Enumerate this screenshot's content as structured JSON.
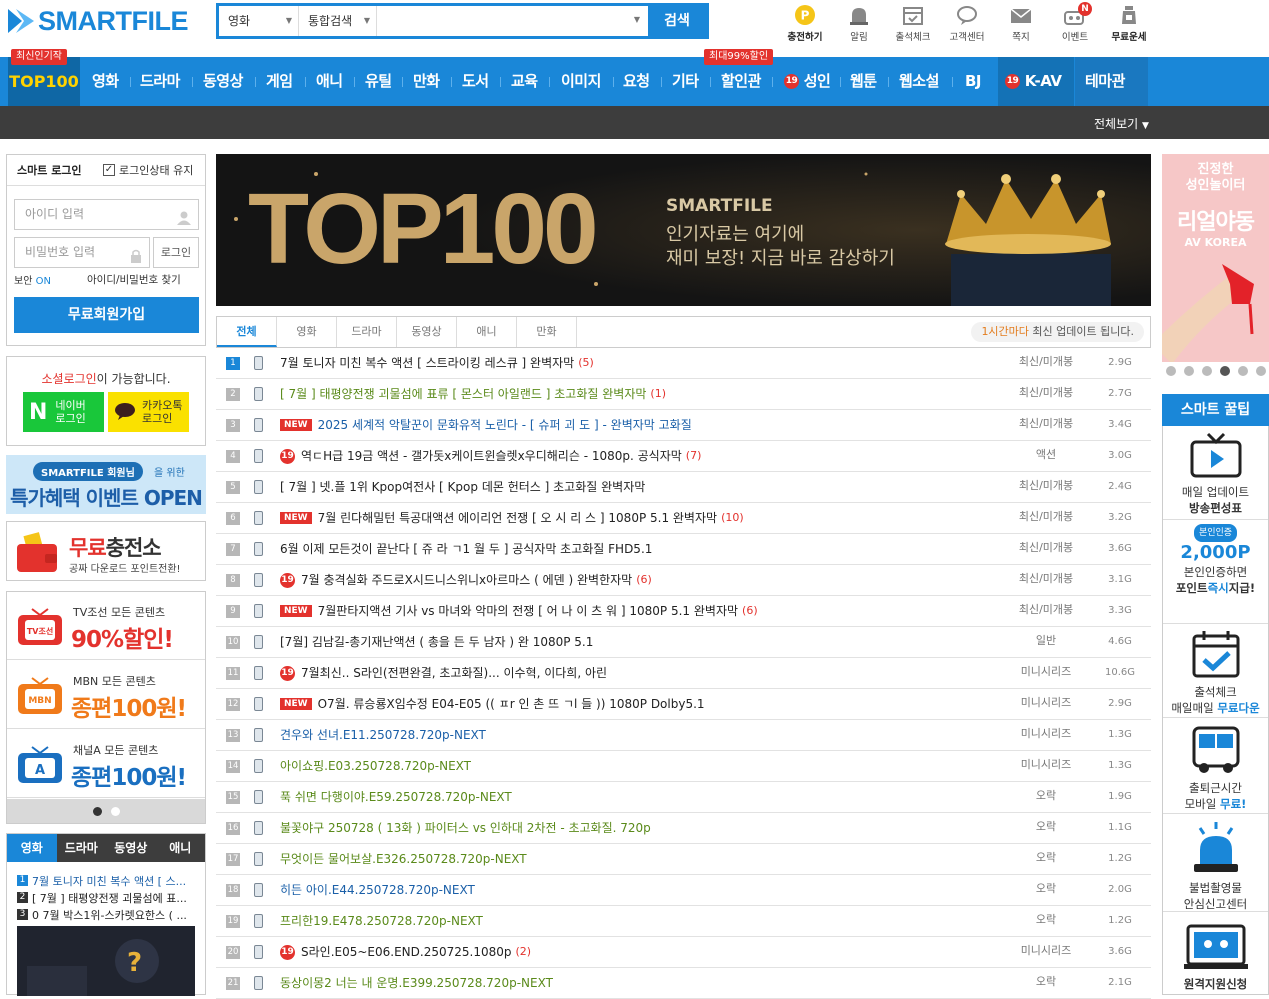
{
  "header": {
    "logo_text": "SMARTFILE",
    "search": {
      "category": "영화",
      "scope": "통합검색",
      "button": "검색",
      "placeholder": ""
    },
    "quick_links": [
      {
        "label": "충전하기",
        "icon": "coin-icon"
      },
      {
        "label": "알림",
        "icon": "alarm-icon"
      },
      {
        "label": "출석체크",
        "icon": "calendar-check-icon"
      },
      {
        "label": "고객센터",
        "icon": "chat-bubble-icon"
      },
      {
        "label": "쪽지",
        "icon": "mail-icon"
      },
      {
        "label": "이벤트",
        "icon": "gift-icon",
        "badge": "N"
      },
      {
        "label": "무료운세",
        "icon": "fortune-jar-icon"
      }
    ]
  },
  "nav": {
    "top100": "TOP100",
    "top100_flag": "최신인기작",
    "discount_flag": "최대99%할인",
    "items": [
      "영화",
      "드라마",
      "동영상",
      "게임",
      "애니",
      "유틸",
      "만화",
      "도서",
      "교육",
      "이미지",
      "요청",
      "기타",
      "할인관",
      "성인",
      "웹툰",
      "웹소설",
      "BJ",
      "K-AV",
      "테마관"
    ],
    "adult_badge": "19",
    "view_all": "전체보기"
  },
  "login": {
    "title": "스마트 로그인",
    "keep_label": "로그인상태 유지",
    "keep_checked": true,
    "id_placeholder": "아이디 입력",
    "pw_placeholder": "비밀번호 입력",
    "login_button": "로그인",
    "security_label": "보안",
    "security_state": "ON",
    "find_link": "아이디/비밀번호 찾기",
    "join_button": "무료회원가입"
  },
  "social": {
    "text_highlight": "소셜로그인",
    "text_rest": "이 가능합니다.",
    "naver_line1": "네이버",
    "naver_line2": "로그인",
    "kakao_line1": "카카오톡",
    "kakao_line2": "로그인"
  },
  "banners": {
    "event_pill": "SMARTFILE 회원님",
    "event_for": "을 위한",
    "event_big": "특가혜택 이벤트 OPEN",
    "charge_hl": "무료",
    "charge_big": "충전소",
    "charge_sub": "공짜 다운로드 포인트전환!",
    "tv": [
      {
        "logo": "TV조선",
        "line1": "TV조선 모든 콘텐츠",
        "line2": "90%할인!",
        "color": "#e3322d"
      },
      {
        "logo": "MBN",
        "line1": "MBN 모든 콘텐츠",
        "line2": "종편100원!",
        "color": "#f07a1a"
      },
      {
        "logo": "A",
        "line1": "채널A 모든 콘텐츠",
        "line2": "종편100원!",
        "color": "#1a6fc0"
      }
    ]
  },
  "side_tabs": {
    "tabs": [
      "영화",
      "드라마",
      "동영상",
      "애니"
    ],
    "active": 0,
    "items": [
      {
        "n": "1",
        "text": "7월 토니자 미친 복수 액션 [ 스..."
      },
      {
        "n": "2",
        "text": "[ 7월 ] 태평양전쟁 괴물섬에 표..."
      },
      {
        "n": "3",
        "text": "0 7월 박스1위-스카렛요한스 ( ..."
      }
    ]
  },
  "hero": {
    "big": "TOP100",
    "brand": "SMARTFILE",
    "line1": "인기자료는 여기에",
    "line2": "재미 보장! 지금 바로 감상하기"
  },
  "list_tabs": {
    "tabs": [
      "전체",
      "영화",
      "드라마",
      "동영상",
      "애니",
      "만화"
    ],
    "active": 0,
    "update_hl": "1시간마다",
    "update_rest": " 최신 업데이트 됩니다."
  },
  "list": [
    {
      "n": "1",
      "badge": "",
      "title": "7월 토니자 미친 복수 액션 [ 스트라이킹 레스큐 ] 완벽자막",
      "count": "(5)",
      "cat": "최신/미개봉",
      "size": "2.9G",
      "color": "black"
    },
    {
      "n": "2",
      "badge": "",
      "title": "[ 7월 ] 태평양전쟁 괴물섬에 표류 [ 몬스터 아일랜드 ] 초고화질 완벽자막",
      "count": "(1)",
      "cat": "최신/미개봉",
      "size": "2.7G",
      "color": "green"
    },
    {
      "n": "3",
      "badge": "NEW",
      "title": "2025 세계적 악탈꾼이 문화유적 노린다 - [ 슈퍼 괴 도 ] - 완벽자막 고화질",
      "count": "",
      "cat": "최신/미개봉",
      "size": "3.4G",
      "color": "blue"
    },
    {
      "n": "4",
      "badge": "19",
      "title": "역ㄷH급 19금 액션 - 갤가돗x케이트윈슬렛x우디해리슨 - 1080p. 공식자막",
      "count": "(7)",
      "cat": "액션",
      "size": "3.0G",
      "color": "black"
    },
    {
      "n": "5",
      "badge": "",
      "title": "[ 7월 ] 넷.플 1위 Kpop여전사 [ Kpop 데몬 헌터스 ] 초고화질 완벽자막",
      "count": "",
      "cat": "최신/미개봉",
      "size": "2.4G",
      "color": "black"
    },
    {
      "n": "6",
      "badge": "NEW",
      "title": "7월 린다해밀턴 특공대액션 에이리언 전쟁 [ 오 시 리 스 ] 1080P 5.1 완벽자막",
      "count": "(10)",
      "cat": "최신/미개봉",
      "size": "3.2G",
      "color": "black"
    },
    {
      "n": "7",
      "badge": "",
      "title": "6월 이제 모든것이 끝난다 [ 쥬 라 ㄱ1 월 두 ] 공식자막 초고화질 FHD5.1",
      "count": "",
      "cat": "최신/미개봉",
      "size": "3.6G",
      "color": "black"
    },
    {
      "n": "8",
      "badge": "19",
      "title": "7월 충격실화 주드로X시드니스위니x아르마스 ( 에덴 ) 완벽한자막",
      "count": "(6)",
      "cat": "최신/미개봉",
      "size": "3.1G",
      "color": "black"
    },
    {
      "n": "9",
      "badge": "NEW",
      "title": "7월판타지액션 기사 vs 마녀와 악마의 전쟁 [ 어 나 이 츠 워 ] 1080P 5.1 완벽자막",
      "count": "(6)",
      "cat": "최신/미개봉",
      "size": "3.3G",
      "color": "black"
    },
    {
      "n": "10",
      "badge": "",
      "title": "[7월] 김남길-총기재난액션 ( 총을 든 두 남자 ) 완 1080P 5.1",
      "count": "",
      "cat": "일반",
      "size": "4.6G",
      "color": "black"
    },
    {
      "n": "11",
      "badge": "19",
      "title": "7월최신.. S라인(전편완결, 초고화질)... 이수혁, 이다희, 아린",
      "count": "",
      "cat": "미니시리즈",
      "size": "10.6G",
      "color": "black"
    },
    {
      "n": "12",
      "badge": "NEW",
      "title": "O7월. 류승룡X임수정 E04-E05 (( ㅍr 인 촌 뜨 ㄱl 들 )) 1080P Dolby5.1",
      "count": "",
      "cat": "미니시리즈",
      "size": "2.9G",
      "color": "black"
    },
    {
      "n": "13",
      "badge": "",
      "title": "견우와 선녀.E11.250728.720p-NEXT",
      "count": "",
      "cat": "미니시리즈",
      "size": "1.3G",
      "color": "blue"
    },
    {
      "n": "14",
      "badge": "",
      "title": "아이쇼핑.E03.250728.720p-NEXT",
      "count": "",
      "cat": "미니시리즈",
      "size": "1.3G",
      "color": "green"
    },
    {
      "n": "15",
      "badge": "",
      "title": "푹 쉬면 다행이야.E59.250728.720p-NEXT",
      "count": "",
      "cat": "오락",
      "size": "1.9G",
      "color": "green"
    },
    {
      "n": "16",
      "badge": "",
      "title": "불꽃야구 250728 ( 13화 ) 파이터스 vs 인하대 2차전 - 초고화질. 720p",
      "count": "",
      "cat": "오락",
      "size": "1.1G",
      "color": "green"
    },
    {
      "n": "17",
      "badge": "",
      "title": "무엇이든 물어보살.E326.250728.720p-NEXT",
      "count": "",
      "cat": "오락",
      "size": "1.2G",
      "color": "green"
    },
    {
      "n": "18",
      "badge": "",
      "title": "히든 아이.E44.250728.720p-NEXT",
      "count": "",
      "cat": "오락",
      "size": "2.0G",
      "color": "blue"
    },
    {
      "n": "19",
      "badge": "",
      "title": "프리한19.E478.250728.720p-NEXT",
      "count": "",
      "cat": "오락",
      "size": "1.2G",
      "color": "green"
    },
    {
      "n": "20",
      "badge": "19",
      "title": "S라인.E05~E06.END.250725.1080p",
      "count": "(2)",
      "cat": "미니시리즈",
      "size": "3.6G",
      "color": "black"
    },
    {
      "n": "21",
      "badge": "",
      "title": "동상이몽2 너는 내 운명.E399.250728.720p-NEXT",
      "count": "",
      "cat": "오락",
      "size": "2.1G",
      "color": "green"
    }
  ],
  "right_banner": {
    "line1": "진정한",
    "line2": "성인놀이터",
    "big": "리얼야동",
    "brand": "AV KOREA",
    "dots": 6,
    "active_dot": 3
  },
  "tips": {
    "title": "스마트 꿀팁",
    "items": [
      {
        "icon": "tv-play-icon",
        "l1": "매일 업데이트",
        "l2": "방송편성표",
        "l2_style": "bold"
      },
      {
        "icon": "verify-points-icon",
        "pill": "본인인증",
        "big": "2,000P",
        "l1": "본인인증하면",
        "l2a": "포인트",
        "l2b": "즉시",
        "l2c": "지급!"
      },
      {
        "icon": "calendar-check-icon",
        "l1": "출석체크",
        "l2a": "매일매일 ",
        "l2b": "무료다운"
      },
      {
        "icon": "bus-icon",
        "l1": "출퇴근시간",
        "l2a": "모바일 ",
        "l2b": "무료!"
      },
      {
        "icon": "siren-icon",
        "l1": "불법촬영물",
        "l2": "안심신고센터"
      },
      {
        "icon": "remote-support-icon",
        "l1": "원격지원신청"
      }
    ]
  },
  "colors": {
    "brand": "#1a87d8",
    "accent": "#e3322d",
    "dark": "#3d3d3d"
  }
}
